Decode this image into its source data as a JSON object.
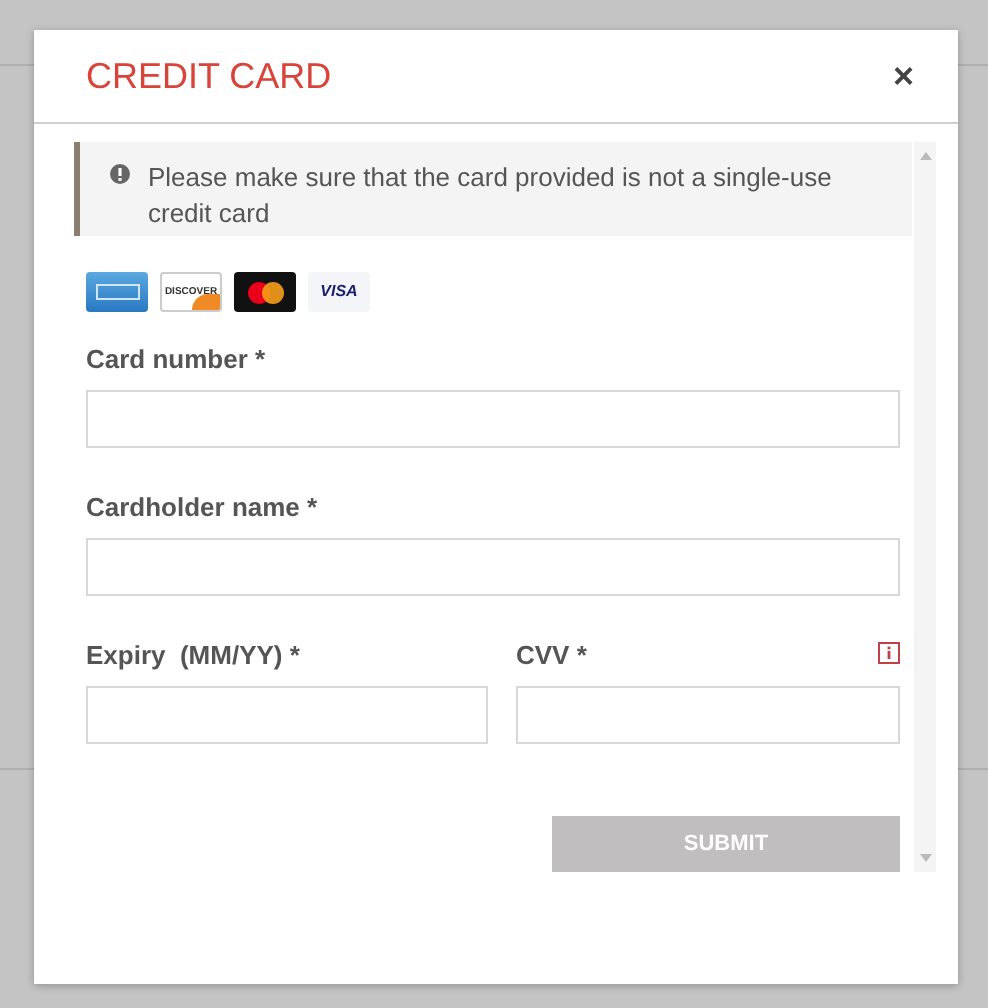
{
  "dialog": {
    "title": "CREDIT CARD",
    "close": "×"
  },
  "notice": "Please make sure that the card provided is not a single-use credit card",
  "cards": [
    {
      "kind": "amex"
    },
    {
      "kind": "discover",
      "label": "DISCOVER"
    },
    {
      "kind": "mastercard"
    },
    {
      "kind": "visa",
      "label": "VISA"
    }
  ],
  "fields": [
    {
      "label": "Card number *"
    },
    {
      "label": "Cardholder name *"
    }
  ],
  "row_fields": [
    {
      "label": "Expiry  (MM/YY) *",
      "info": false
    },
    {
      "label": "CVV *",
      "info": true
    }
  ],
  "submit": {
    "label": "SUBMIT",
    "disabled": true
  }
}
